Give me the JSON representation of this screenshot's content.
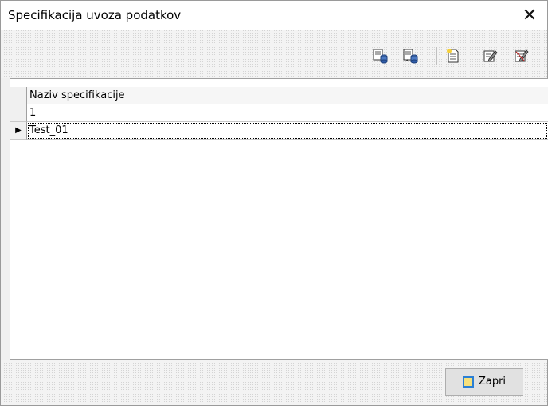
{
  "window": {
    "title": "Specifikacija uvoza podatkov"
  },
  "toolbar": {
    "buttons": [
      {
        "icon": "export-icon"
      },
      {
        "icon": "import-icon"
      },
      {
        "icon": "new-document-icon"
      },
      {
        "icon": "edit-icon"
      },
      {
        "icon": "delete-icon"
      }
    ]
  },
  "grid": {
    "column_header": "Naziv specifikacije",
    "rows": [
      {
        "value": "1",
        "selected": false
      },
      {
        "value": "Test_01",
        "selected": true
      }
    ],
    "selected_indicator": "▶"
  },
  "footer": {
    "close_label": "Zapri"
  }
}
